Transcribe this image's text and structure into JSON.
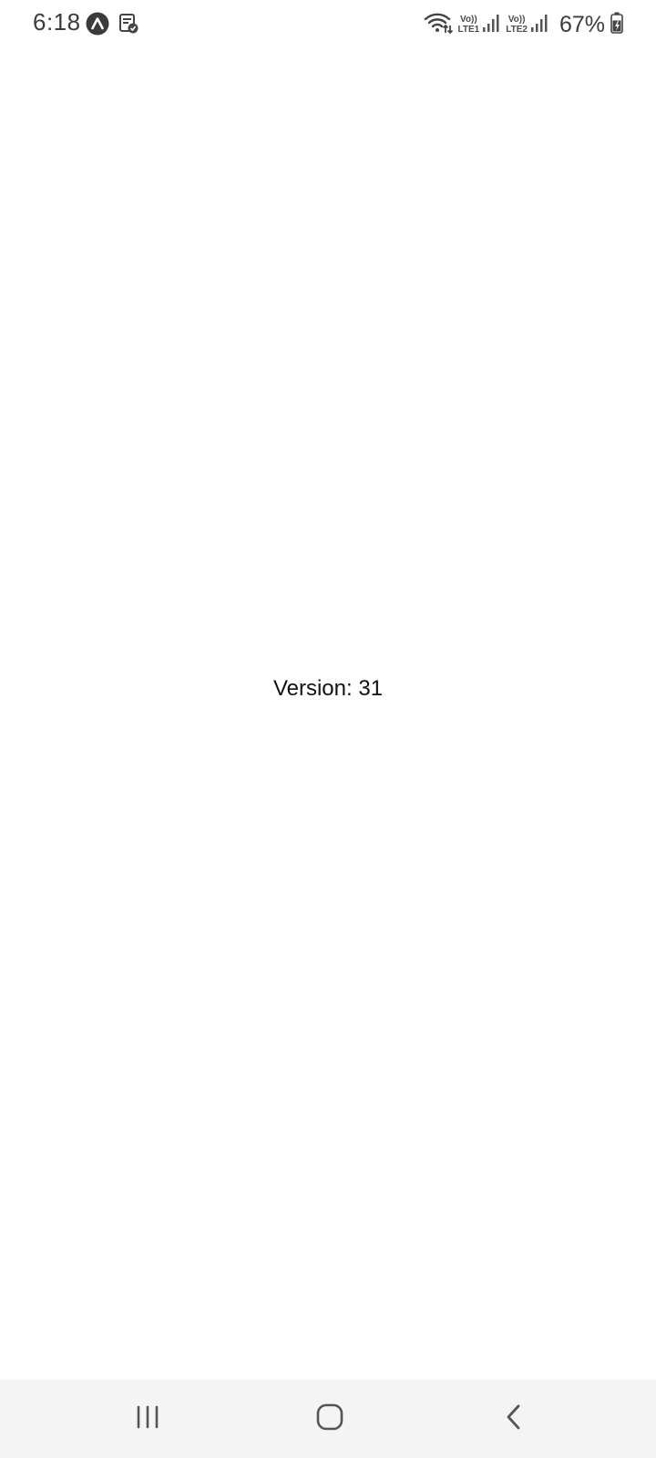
{
  "status_bar": {
    "time": "6:18",
    "left_icons": [
      "app-notification-icon",
      "clipboard-check-icon"
    ],
    "wifi_icon": "wifi-icon",
    "sim1": {
      "top": "Vo))",
      "bottom": "LTE1"
    },
    "sim2": {
      "top": "Vo))",
      "bottom": "LTE2"
    },
    "battery_percent": "67%",
    "battery_icon": "battery-charging-icon"
  },
  "main": {
    "version_text": "Version: 31"
  },
  "nav_bar": {
    "recents_icon": "recents-icon",
    "home_icon": "home-icon",
    "back_icon": "back-icon"
  },
  "colors": {
    "background": "#ffffff",
    "nav_background": "#f4f4f4",
    "icon_gray": "#555555",
    "text": "#111111"
  }
}
